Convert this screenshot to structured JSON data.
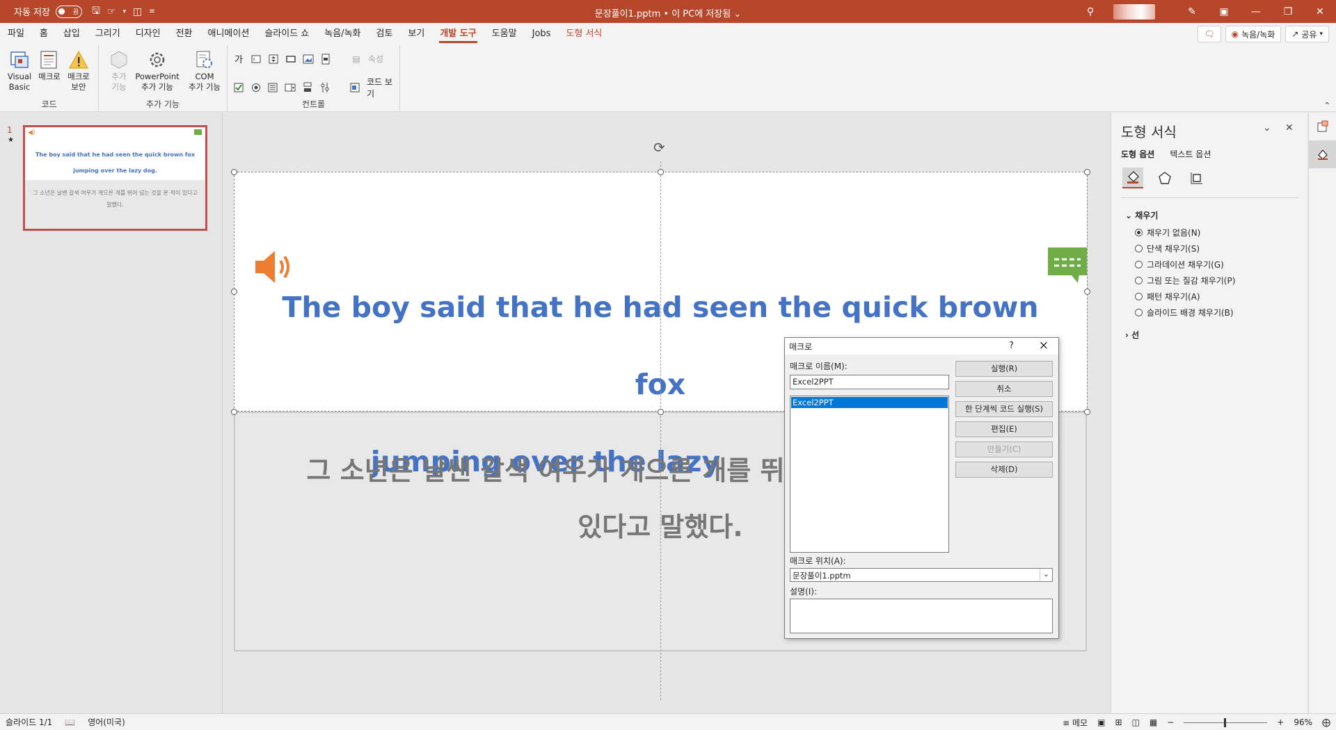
{
  "titlebar": {
    "autosave_label": "자동 저장",
    "autosave_state": "끔",
    "doc_title": "문장풀이1.pptm • 이 PC에 저장됨 ⌄"
  },
  "menu": {
    "tabs": [
      "파일",
      "홈",
      "삽입",
      "그리기",
      "디자인",
      "전환",
      "애니메이션",
      "슬라이드 쇼",
      "녹음/녹화",
      "검토",
      "보기",
      "개발 도구",
      "도움말",
      "Jobs",
      "도형 서식"
    ],
    "active_tab": "개발 도구",
    "record_btn": "녹음/녹화",
    "share_btn": "공유"
  },
  "ribbon": {
    "code_group": "코드",
    "addins_group": "추가 기능",
    "controls_group": "컨트롤",
    "visual_basic_1": "Visual",
    "visual_basic_2": "Basic",
    "macro": "매크로",
    "macro_security_1": "매크로",
    "macro_security_2": "보안",
    "addins_1": "추가",
    "addins_2": "기능",
    "ppt_addins_1": "PowerPoint",
    "ppt_addins_2": "추가 기능",
    "com_addins_1": "COM",
    "com_addins_2": "추가 기능",
    "properties": "속성",
    "view_code": "코드 보기",
    "label_ctl": "가"
  },
  "thumbnail": {
    "number": "1",
    "en": "The boy said that he had seen the quick brown fox jumping over the lazy dog.",
    "ko": "그 소년은 날쌘 갈색 여우가 게으른 개를 뛰어 넘는 것을 본 적이 있다고 말했다."
  },
  "slide": {
    "english_line1": "The boy said that he had seen the quick brown fox",
    "english_line2": "jumping over the lazy",
    "korean_line1": "그 소년은 날쌘 갈색 여우가 게으른 개를 뛰",
    "korean_line2": "있다고 말했다."
  },
  "macro_dialog": {
    "title": "매크로",
    "help": "?",
    "name_label": "매크로 이름(M):",
    "name_value": "Excel2PPT",
    "list_items": [
      "Excel2PPT"
    ],
    "btn_run": "실행(R)",
    "btn_cancel": "취소",
    "btn_step": "한 단계씩 코드 실행(S)",
    "btn_edit": "편집(E)",
    "btn_create": "만들기(C)",
    "btn_delete": "삭제(D)",
    "location_label": "매크로 위치(A):",
    "location_value": "문장풀이1.pptm",
    "desc_label": "설명(I):"
  },
  "format_pane": {
    "title": "도형 서식",
    "tab_shape": "도형 옵션",
    "tab_text": "텍스트 옵션",
    "fill_section": "채우기",
    "fill_options": [
      "채우기 없음(N)",
      "단색 채우기(S)",
      "그라데이션 채우기(G)",
      "그림 또는 질감 채우기(P)",
      "패턴 채우기(A)",
      "슬라이드 배경 채우기(B)"
    ],
    "line_section": "선"
  },
  "statusbar": {
    "slide_info": "슬라이드 1/1",
    "language": "영어(미국)",
    "notes": "메모",
    "zoom": "96%"
  },
  "colors": {
    "accent": "#b7472a",
    "english_text": "#4472c4",
    "korean_text": "#767676",
    "speaker": "#ed7d31",
    "chat": "#70ad47"
  }
}
